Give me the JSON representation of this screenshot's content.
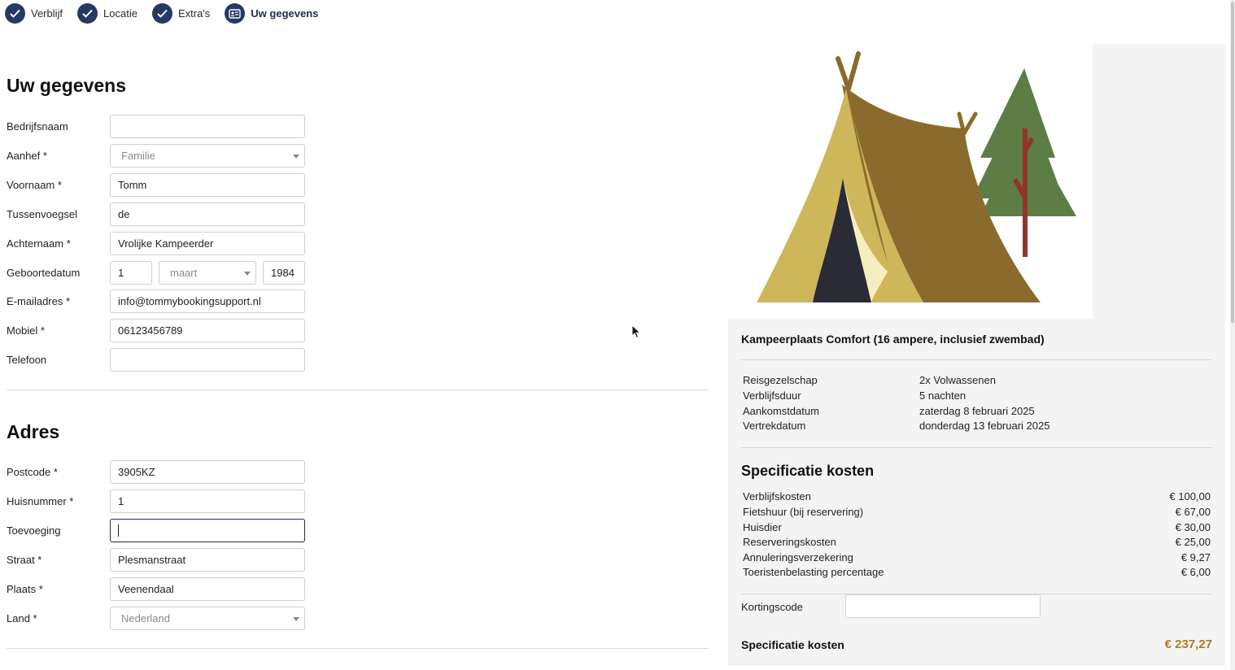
{
  "steps": [
    {
      "label": "Verblijf"
    },
    {
      "label": "Locatie"
    },
    {
      "label": "Extra's"
    },
    {
      "label": "Uw gegevens"
    }
  ],
  "personal": {
    "title": "Uw gegevens",
    "company_label": "Bedrijfsnaam",
    "company_value": "",
    "salutation_label": "Aanhef *",
    "salutation_value": "Familie",
    "firstname_label": "Voornaam *",
    "firstname_value": "Tomm",
    "infix_label": "Tussenvoegsel",
    "infix_value": "de",
    "lastname_label": "Achternaam *",
    "lastname_value": "Vrolijke Kampeerder",
    "birthdate_label": "Geboortedatum",
    "birth_day": "1",
    "birth_month": "maart",
    "birth_year": "1984",
    "email_label": "E-mailadres *",
    "email_value": "info@tommybookingsupport.nl",
    "mobile_label": "Mobiel *",
    "mobile_value": "06123456789",
    "phone_label": "Telefoon",
    "phone_value": ""
  },
  "address": {
    "title": "Adres",
    "postcode_label": "Postcode *",
    "postcode_value": "3905KZ",
    "housenumber_label": "Huisnummer *",
    "housenumber_value": "1",
    "addition_label": "Toevoeging",
    "addition_value": "",
    "street_label": "Straat *",
    "street_value": "Plesmanstraat",
    "city_label": "Plaats *",
    "city_value": "Veenendaal",
    "country_label": "Land *",
    "country_value": "Nederland"
  },
  "summary": {
    "title": "Kampeerplaats Comfort (16 ampere, inclusief zwembad)",
    "info": [
      {
        "key": "Reisgezelschap",
        "value": "2x Volwassenen"
      },
      {
        "key": "Verblijfsduur",
        "value": "5 nachten"
      },
      {
        "key": "Aankomstdatum",
        "value": "zaterdag 8 februari 2025"
      },
      {
        "key": "Vertrekdatum",
        "value": "donderdag 13 februari 2025"
      }
    ],
    "spec_title": "Specificatie kosten",
    "costs": [
      {
        "label": "Verblijfskosten",
        "amount": "€ 100,00"
      },
      {
        "label": "Fietshuur (bij reservering)",
        "amount": "€ 67,00"
      },
      {
        "label": "Huisdier",
        "amount": "€ 30,00"
      },
      {
        "label": "Reserveringskosten",
        "amount": "€ 25,00"
      },
      {
        "label": "Annuleringsverzekering",
        "amount": "€ 9,27"
      },
      {
        "label": "Toeristenbelasting percentage",
        "amount": "€ 6,00"
      }
    ],
    "discount_label": "Kortingscode",
    "discount_value": "",
    "total_label": "Specificatie kosten",
    "total_value": "€ 237,27"
  },
  "colors": {
    "step_circle": "#243a64",
    "total_accent": "#b07a1e",
    "tent_dark": "#8b6b2d",
    "tent_light": "#cdb75a",
    "tree": "#5e7d45",
    "trunk": "#93342a"
  }
}
